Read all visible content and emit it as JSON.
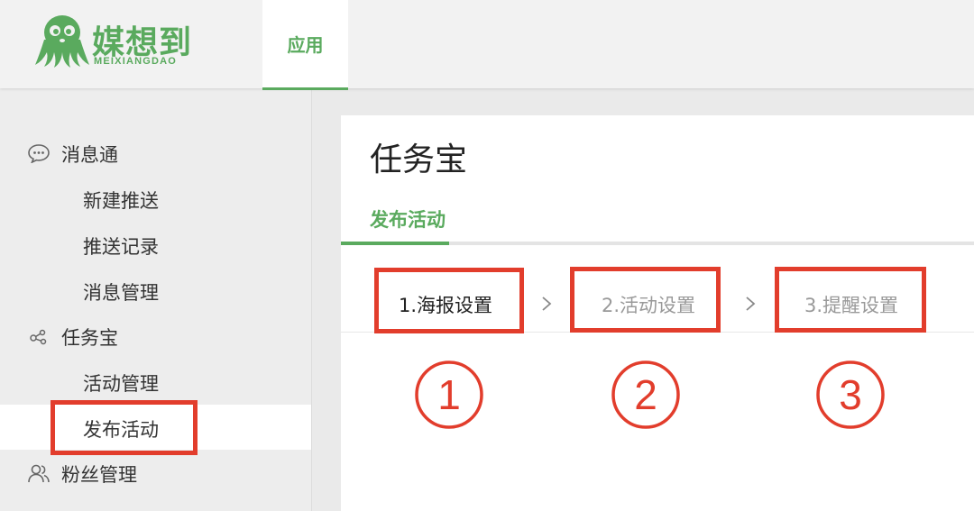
{
  "header": {
    "logo": {
      "name": "媒想到",
      "subtitle": "MEIXIANGDAO",
      "icon": "octopus-logo"
    },
    "tab_label": "应用"
  },
  "sidebar": {
    "groups": [
      {
        "label": "消息通",
        "icon": "chat-bubble-icon",
        "items": [
          {
            "label": "新建推送"
          },
          {
            "label": "推送记录"
          },
          {
            "label": "消息管理"
          }
        ]
      },
      {
        "label": "任务宝",
        "icon": "share-nodes-icon",
        "items": [
          {
            "label": "活动管理"
          },
          {
            "label": "发布活动",
            "active": true
          }
        ]
      },
      {
        "label": "粉丝管理",
        "icon": "users-icon",
        "items": []
      }
    ]
  },
  "main": {
    "title": "任务宝",
    "subtab": "发布活动",
    "steps": [
      {
        "label": "1.海报设置",
        "current": true
      },
      {
        "label": "2.活动设置",
        "current": false
      },
      {
        "label": "3.提醒设置",
        "current": false
      }
    ]
  },
  "annotations": {
    "color": "#e23d2c",
    "numbers": [
      "1",
      "2",
      "3"
    ]
  },
  "colors": {
    "brand_green": "#5aaa5e",
    "annotation_red": "#e23d2c"
  }
}
